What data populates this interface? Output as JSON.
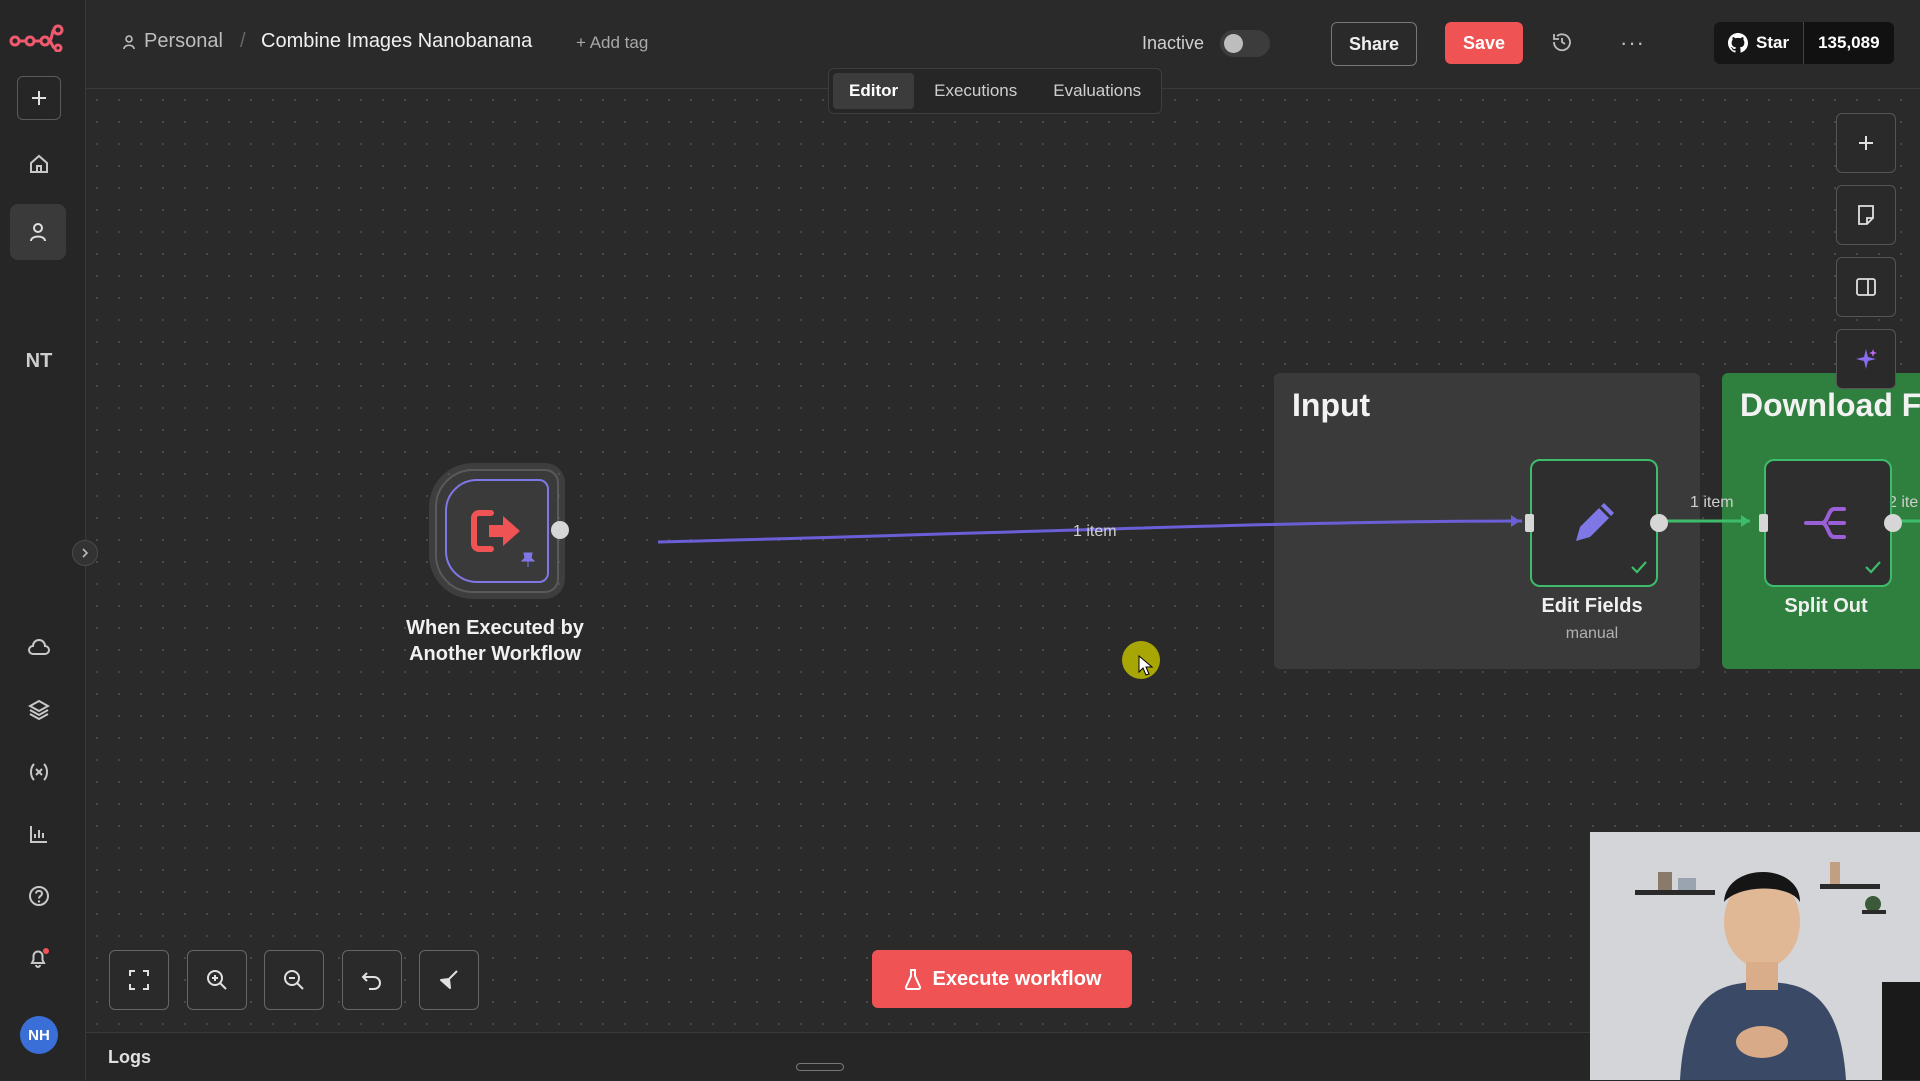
{
  "header": {
    "breadcrumb_personal": "Personal",
    "breadcrumb_sep": "/",
    "workflow_title": "Combine Images Nanobanana",
    "add_tag": "+ Add tag",
    "status_label": "Inactive",
    "share_label": "Share",
    "save_label": "Save",
    "more_label": "···",
    "github_star": "Star",
    "github_count": "135,089"
  },
  "tabs": [
    {
      "label": "Editor",
      "active": true
    },
    {
      "label": "Executions",
      "active": false
    },
    {
      "label": "Evaluations",
      "active": false
    }
  ],
  "sidebar": {
    "project_initials": "NT",
    "user_initials": "NH"
  },
  "canvas": {
    "nodes": {
      "trigger": {
        "label_line1": "When Executed by",
        "label_line2": "Another Workflow"
      },
      "edit_fields": {
        "label": "Edit Fields",
        "subtitle": "manual"
      },
      "split_out": {
        "label": "Split Out"
      }
    },
    "sticky_notes": {
      "input": "Input",
      "download": "Download Fi"
    },
    "connections": {
      "trigger_to_edit": "1 item",
      "edit_to_split": "1 item",
      "split_out_next": "2 ite"
    }
  },
  "controls": {
    "execute_label": "Execute workflow"
  },
  "logs": {
    "label": "Logs"
  },
  "colors": {
    "accent": "#ef5353",
    "success": "#3dbd6b",
    "connection": "#6b5fd8",
    "sticky_green": "#2f7f3f"
  }
}
